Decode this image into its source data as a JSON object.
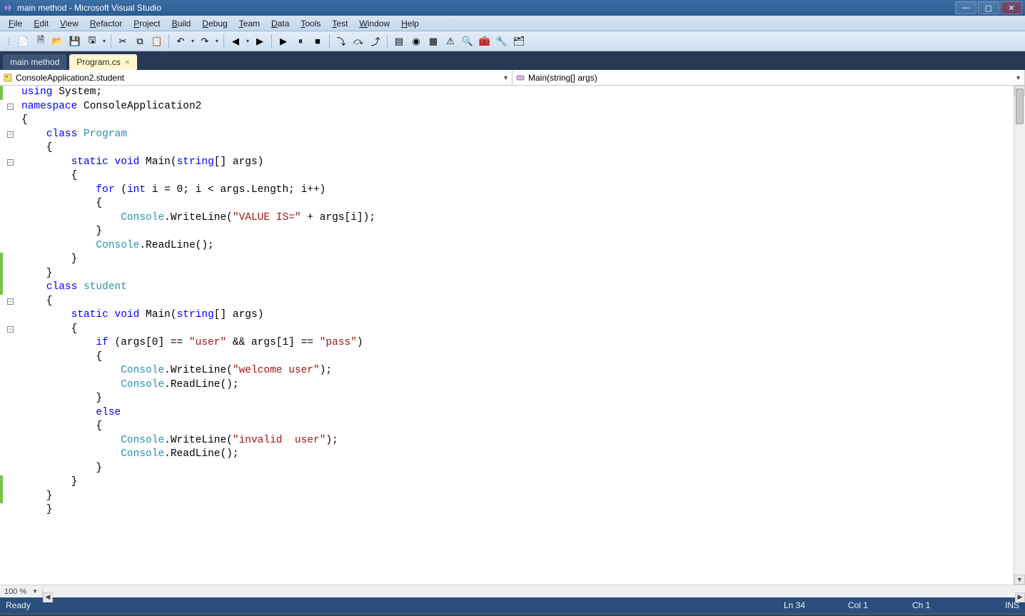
{
  "window": {
    "title": "main method - Microsoft Visual Studio"
  },
  "menu": {
    "items": [
      "File",
      "Edit",
      "View",
      "Refactor",
      "Project",
      "Build",
      "Debug",
      "Team",
      "Data",
      "Tools",
      "Test",
      "Window",
      "Help"
    ]
  },
  "toolbar": {
    "icons": [
      "new-project-icon",
      "new-file-icon",
      "open-file-icon",
      "save-icon",
      "save-all-icon",
      "sep",
      "cut-icon",
      "copy-icon",
      "paste-icon",
      "sep",
      "undo-icon",
      "redo-icon",
      "sep",
      "nav-back-icon",
      "nav-fwd-icon",
      "sep",
      "start-debug-icon",
      "pause-icon",
      "stop-icon",
      "sep",
      "step-into-icon",
      "step-over-icon",
      "step-out-icon",
      "sep",
      "immediate-icon",
      "breakpoints-icon",
      "output-icon",
      "error-list-icon",
      "find-icon",
      "toolbox-icon",
      "properties-icon",
      "solution-explorer-icon"
    ]
  },
  "tabs": [
    {
      "label": "main method",
      "active": false
    },
    {
      "label": "Program.cs",
      "active": true
    }
  ],
  "navbar": {
    "class_dd": "ConsoleApplication2.student",
    "member_dd": "Main(string[] args)"
  },
  "code": {
    "lines": [
      {
        "t": [
          [
            "kw",
            "using"
          ],
          [
            "",
            " System;"
          ]
        ]
      },
      {
        "t": [
          [
            "kw",
            "namespace"
          ],
          [
            "",
            " ConsoleApplication2"
          ]
        ],
        "fold": true
      },
      {
        "t": [
          [
            "",
            "{"
          ]
        ]
      },
      {
        "t": [
          [
            "",
            "    "
          ],
          [
            "kw",
            "class"
          ],
          [
            "",
            " "
          ],
          [
            "cls",
            "Program"
          ]
        ],
        "fold": true
      },
      {
        "t": [
          [
            "",
            "    {"
          ]
        ]
      },
      {
        "t": [
          [
            "",
            "        "
          ],
          [
            "kw",
            "static"
          ],
          [
            "",
            " "
          ],
          [
            "kw",
            "void"
          ],
          [
            "",
            " Main("
          ],
          [
            "kw",
            "string"
          ],
          [
            "",
            "[] args)"
          ]
        ],
        "fold": true
      },
      {
        "t": [
          [
            "",
            "        {"
          ]
        ]
      },
      {
        "t": [
          [
            "",
            "            "
          ],
          [
            "kw",
            "for"
          ],
          [
            "",
            " ("
          ],
          [
            "kw",
            "int"
          ],
          [
            "",
            " i = 0; i < args.Length; i++)"
          ]
        ]
      },
      {
        "t": [
          [
            "",
            "            {"
          ]
        ]
      },
      {
        "t": [
          [
            "",
            "                "
          ],
          [
            "cls",
            "Console"
          ],
          [
            "",
            ".WriteLine("
          ],
          [
            "str",
            "\"VALUE IS=\""
          ],
          [
            "",
            " + args[i]);"
          ]
        ]
      },
      {
        "t": [
          [
            "",
            ""
          ]
        ]
      },
      {
        "t": [
          [
            "",
            "            }"
          ]
        ]
      },
      {
        "t": [
          [
            "",
            "            "
          ],
          [
            "cls",
            "Console"
          ],
          [
            "",
            ".ReadLine();"
          ]
        ]
      },
      {
        "t": [
          [
            "",
            "        }"
          ]
        ]
      },
      {
        "t": [
          [
            "",
            "    }"
          ]
        ]
      },
      {
        "t": [
          [
            "",
            "    "
          ],
          [
            "kw",
            "class"
          ],
          [
            "",
            " "
          ],
          [
            "cls",
            "student"
          ]
        ],
        "fold": true
      },
      {
        "t": [
          [
            "",
            "    {"
          ]
        ]
      },
      {
        "t": [
          [
            "",
            "        "
          ],
          [
            "kw",
            "static"
          ],
          [
            "",
            " "
          ],
          [
            "kw",
            "void"
          ],
          [
            "",
            " Main("
          ],
          [
            "kw",
            "string"
          ],
          [
            "",
            "[] args)"
          ]
        ],
        "fold": true
      },
      {
        "t": [
          [
            "",
            "        {"
          ]
        ]
      },
      {
        "t": [
          [
            "",
            "            "
          ],
          [
            "kw",
            "if"
          ],
          [
            "",
            " (args[0] == "
          ],
          [
            "str",
            "\"user\""
          ],
          [
            "",
            " && args[1] == "
          ],
          [
            "str",
            "\"pass\""
          ],
          [
            "",
            ")"
          ]
        ]
      },
      {
        "t": [
          [
            "",
            "            {"
          ]
        ]
      },
      {
        "t": [
          [
            "",
            "                "
          ],
          [
            "cls",
            "Console"
          ],
          [
            "",
            ".WriteLine("
          ],
          [
            "str",
            "\"welcome user\""
          ],
          [
            "",
            ");"
          ]
        ]
      },
      {
        "t": [
          [
            "",
            "                "
          ],
          [
            "cls",
            "Console"
          ],
          [
            "",
            ".ReadLine();"
          ]
        ]
      },
      {
        "t": [
          [
            "",
            "            }"
          ]
        ]
      },
      {
        "t": [
          [
            "",
            "            "
          ],
          [
            "kw",
            "else"
          ]
        ]
      },
      {
        "t": [
          [
            "",
            "            {"
          ]
        ]
      },
      {
        "t": [
          [
            "",
            "                "
          ],
          [
            "cls",
            "Console"
          ],
          [
            "",
            ".WriteLine("
          ],
          [
            "str",
            "\"invalid  user\""
          ],
          [
            "",
            ");"
          ]
        ]
      },
      {
        "t": [
          [
            "",
            "                "
          ],
          [
            "cls",
            "Console"
          ],
          [
            "",
            ".ReadLine();"
          ]
        ]
      },
      {
        "t": [
          [
            "",
            "            }"
          ]
        ]
      },
      {
        "t": [
          [
            "",
            "        }"
          ]
        ]
      },
      {
        "t": [
          [
            "",
            ""
          ]
        ]
      },
      {
        "t": [
          [
            "",
            "    }"
          ]
        ]
      },
      {
        "t": [
          [
            "",
            "    }"
          ]
        ]
      }
    ],
    "green_marks": [
      [
        0,
        0
      ],
      [
        12,
        14
      ],
      [
        28,
        29
      ]
    ]
  },
  "zoom": "100 %",
  "status": {
    "ready": "Ready",
    "ln": "Ln 34",
    "col": "Col 1",
    "ch": "Ch 1",
    "ins": "INS"
  }
}
